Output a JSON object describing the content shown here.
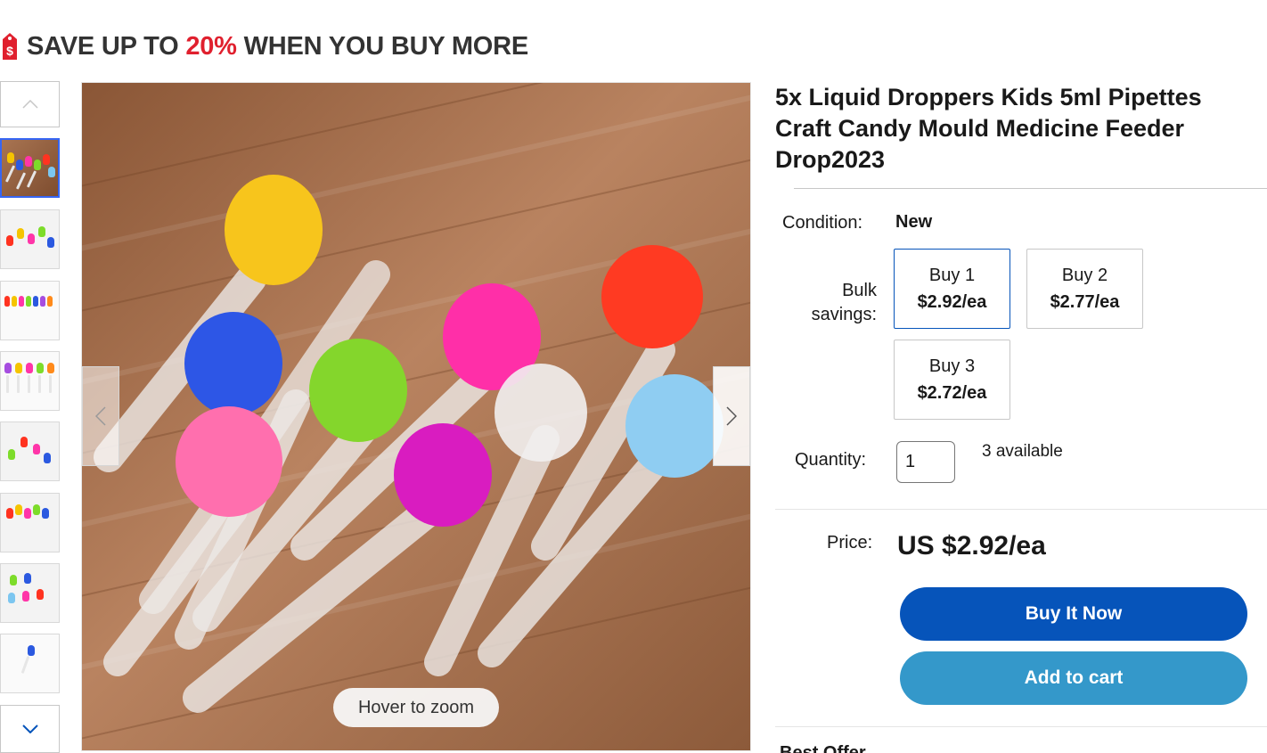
{
  "promo": {
    "part1": "SAVE UP TO ",
    "highlight": "20%",
    "part2": " WHEN YOU BUY MORE",
    "icon": "price-tag-icon",
    "highlight_color": "#e0202e"
  },
  "gallery": {
    "hover_zoom": "Hover to zoom",
    "thumbnail_count": 8,
    "selected_index": 0
  },
  "product": {
    "title": "5x Liquid Droppers Kids 5ml Pipettes Craft Candy Mould Medicine Feeder Drop2023",
    "condition_label": "Condition:",
    "condition_value": "New",
    "bulk_label_1": "Bulk",
    "bulk_label_2": "savings:",
    "bulk_options": [
      {
        "qty": "Buy 1",
        "price": "$2.92/ea",
        "selected": true
      },
      {
        "qty": "Buy 2",
        "price": "$2.77/ea",
        "selected": false
      },
      {
        "qty": "Buy 3",
        "price": "$2.72/ea",
        "selected": false
      }
    ],
    "quantity_label": "Quantity:",
    "quantity_value": "1",
    "available": "3 available",
    "price_label": "Price:",
    "price_value": "US $2.92/ea"
  },
  "actions": {
    "buy_now": "Buy It Now",
    "add_to_cart": "Add to cart",
    "buy_color": "#0654ba",
    "cart_color": "#3498ca"
  },
  "cut_off_text": "Best Offer"
}
